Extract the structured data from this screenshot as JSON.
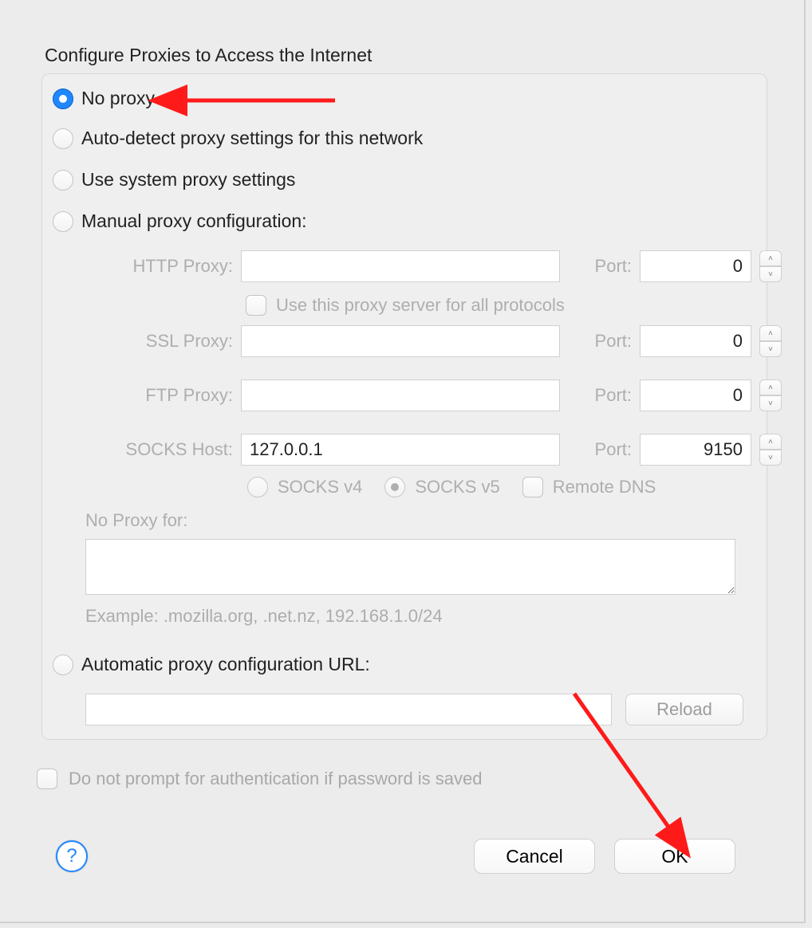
{
  "title": "Configure Proxies to Access the Internet",
  "radios": {
    "no_proxy": "No proxy",
    "auto_detect": "Auto-detect proxy settings for this network",
    "system": "Use system proxy settings",
    "manual": "Manual proxy configuration:",
    "pac": "Automatic proxy configuration URL:"
  },
  "proxy_rows": {
    "http": {
      "label": "HTTP Proxy:",
      "host": "",
      "port_label": "Port:",
      "port": "0"
    },
    "ssl": {
      "label": "SSL Proxy:",
      "host": "",
      "port_label": "Port:",
      "port": "0"
    },
    "ftp": {
      "label": "FTP Proxy:",
      "host": "",
      "port_label": "Port:",
      "port": "0"
    },
    "socks": {
      "label": "SOCKS Host:",
      "host": "127.0.0.1",
      "port_label": "Port:",
      "port": "9150"
    }
  },
  "share_all": "Use this proxy server for all protocols",
  "socks_version": {
    "v4": "SOCKS v4",
    "v5": "SOCKS v5",
    "remote_dns": "Remote DNS"
  },
  "no_proxy_for": {
    "label": "No Proxy for:",
    "value": "",
    "example": "Example: .mozilla.org, .net.nz, 192.168.1.0/24"
  },
  "pac_url": "",
  "reload": "Reload",
  "auth_checkbox": "Do not prompt for authentication if password is saved",
  "help": "?",
  "buttons": {
    "cancel": "Cancel",
    "ok": "OK"
  }
}
